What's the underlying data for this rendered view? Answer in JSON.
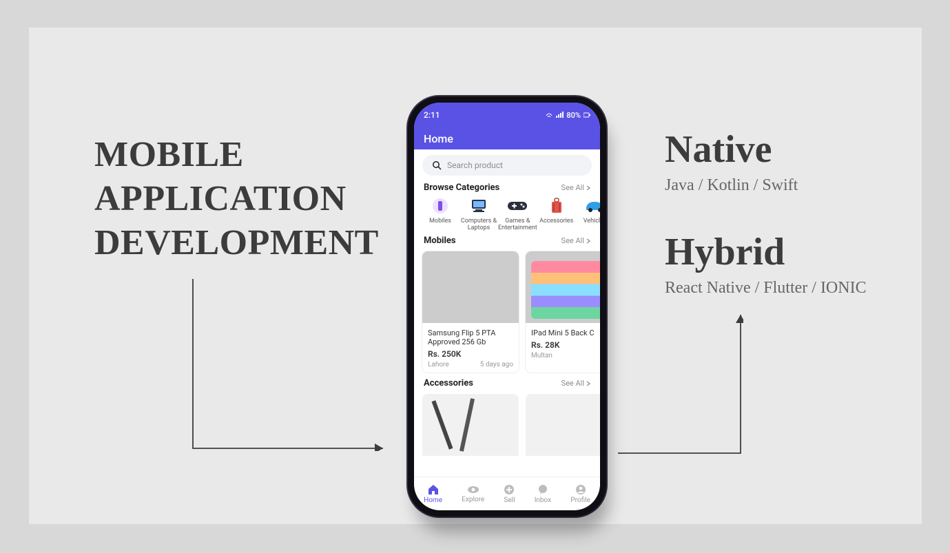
{
  "title": {
    "line1": "MOBILE",
    "line2": "APPLICATION",
    "line3": "DEVELOPMENT"
  },
  "right": {
    "native_heading": "Native",
    "native_sub": "Java / Kotlin / Swift",
    "hybrid_heading": "Hybrid",
    "hybrid_sub": "React Native / Flutter / IONIC"
  },
  "phone": {
    "status": {
      "time": "2:11",
      "battery": "80%"
    },
    "appbar_title": "Home",
    "search_placeholder": "Search product",
    "sections": {
      "categories_title": "Browse Categories",
      "see_all": "See All",
      "categories": [
        {
          "label": "Mobiles"
        },
        {
          "label": "Computers & Laptops"
        },
        {
          "label": "Games & Entertainment"
        },
        {
          "label": "Accessories"
        },
        {
          "label": "Vehicles"
        }
      ],
      "mobiles_title": "Mobiles",
      "mobiles": [
        {
          "title": "Samsung Flip 5 PTA Approved 256 Gb",
          "price": "Rs. 250K",
          "city": "Lahore",
          "time": "5 days ago"
        },
        {
          "title": "IPad Mini 5 Back C",
          "price": "Rs. 28K",
          "city": "Multan",
          "time": ""
        }
      ],
      "accessories_title": "Accessories"
    },
    "bottom_nav": [
      {
        "label": "Home",
        "active": true
      },
      {
        "label": "Explore",
        "active": false
      },
      {
        "label": "Sell",
        "active": false
      },
      {
        "label": "Inbox",
        "active": false
      },
      {
        "label": "Profile",
        "active": false
      }
    ]
  }
}
